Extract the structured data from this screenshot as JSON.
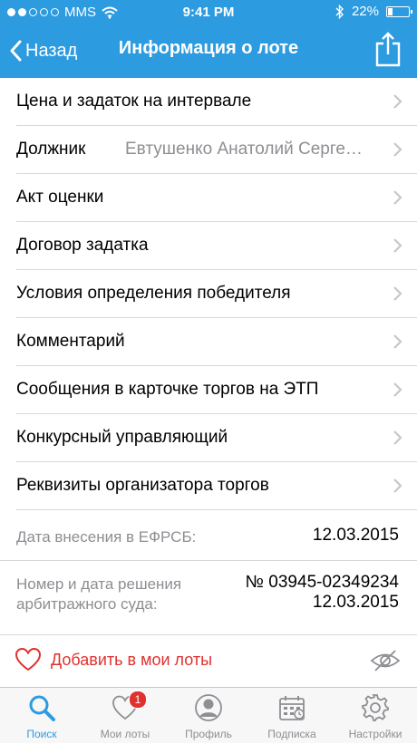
{
  "status_bar": {
    "carrier": "MMS",
    "time": "9:41 PM",
    "battery_percent": "22%",
    "battery_level": 0.22,
    "signal_bars_filled": 2
  },
  "nav": {
    "back_label": "Назад",
    "title": "Информация о лоте"
  },
  "rows": [
    {
      "label": "Цена и задаток на интервале",
      "value": ""
    },
    {
      "label": "Должник",
      "value": "Евтушенко Анатолий Сергеевич"
    },
    {
      "label": "Акт оценки",
      "value": ""
    },
    {
      "label": "Договор задатка",
      "value": ""
    },
    {
      "label": "Условия определения победителя",
      "value": ""
    },
    {
      "label": "Комментарий",
      "value": ""
    },
    {
      "label": "Сообщения в карточке торгов на ЭТП",
      "value": ""
    },
    {
      "label": "Конкурсный управляющий",
      "value": ""
    },
    {
      "label": "Реквизиты организатора торгов",
      "value": ""
    }
  ],
  "info": {
    "efrsb_date_label": "Дата внесения в ЕФРСБ:",
    "efrsb_date_value": "12.03.2015",
    "court_label_line1": "Номер и дата решения",
    "court_label_line2": "арбитражного суда:",
    "court_number": "№ 03945-02349234",
    "court_date": "12.03.2015"
  },
  "favorite": {
    "label": "Добавить в мои лоты"
  },
  "tabbar": {
    "tabs": [
      {
        "label": "Поиск",
        "icon": "search-icon",
        "active": true
      },
      {
        "label": "Мои лоты",
        "icon": "heart-icon",
        "badge": "1"
      },
      {
        "label": "Профиль",
        "icon": "profile-icon"
      },
      {
        "label": "Подписка",
        "icon": "calendar-icon"
      },
      {
        "label": "Настройки",
        "icon": "gear-icon"
      }
    ]
  },
  "colors": {
    "header": "#2d9be0",
    "accent": "#2d9be0",
    "favorite_red": "#e0312e",
    "secondary_text": "#8e8e93"
  }
}
